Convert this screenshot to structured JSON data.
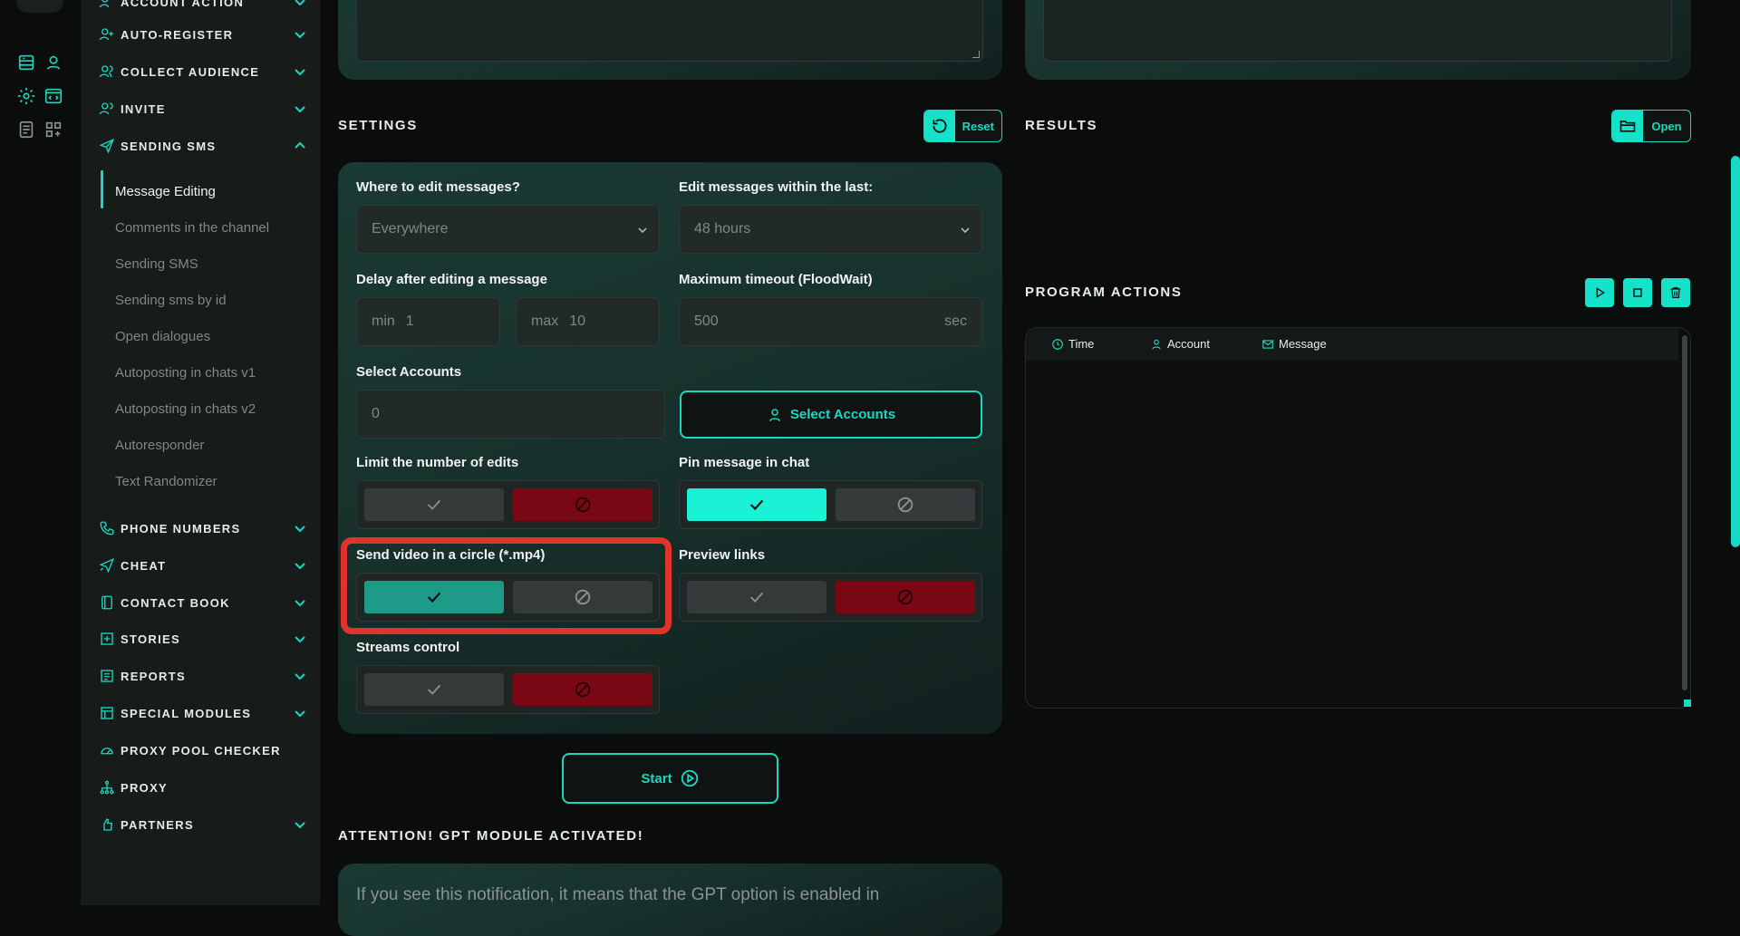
{
  "sidebar": {
    "items": [
      {
        "label": "ACCOUNT ACTION",
        "icon": "user-gear-icon",
        "expanded": false
      },
      {
        "label": "AUTO-REGISTER",
        "icon": "user-plus-icon",
        "expanded": false
      },
      {
        "label": "COLLECT AUDIENCE",
        "icon": "users-icon",
        "expanded": false
      },
      {
        "label": "INVITE",
        "icon": "users-invite-icon",
        "expanded": false
      },
      {
        "label": "SENDING SMS",
        "icon": "paper-plane-icon",
        "expanded": true
      },
      {
        "label": "PHONE NUMBERS",
        "icon": "phone-icon",
        "expanded": false
      },
      {
        "label": "CHEAT",
        "icon": "send-boost-icon",
        "expanded": false
      },
      {
        "label": "CONTACT BOOK",
        "icon": "book-icon",
        "expanded": false
      },
      {
        "label": "STORIES",
        "icon": "plus-square-icon",
        "expanded": false
      },
      {
        "label": "REPORTS",
        "icon": "report-icon",
        "expanded": false
      },
      {
        "label": "SPECIAL MODULES",
        "icon": "modules-icon",
        "expanded": false
      },
      {
        "label": "PROXY POOL CHECKER",
        "icon": "gauge-icon",
        "expanded": false
      },
      {
        "label": "PROXY",
        "icon": "network-icon",
        "expanded": false
      },
      {
        "label": "PARTNERS",
        "icon": "handshake-icon",
        "expanded": false
      }
    ],
    "sending_sms_subitems": [
      "Message Editing",
      "Comments in the channel",
      "Sending SMS",
      "Sending sms by id",
      "Open dialogues",
      "Autoposting in chats v1",
      "Autoposting in chats v2",
      "Autoresponder",
      "Text Randomizer"
    ],
    "active_subitem": "Message Editing"
  },
  "settings": {
    "title": "SETTINGS",
    "reset_label": "Reset",
    "where_label": "Where to edit messages?",
    "where_value": "Everywhere",
    "within_label": "Edit messages within the last:",
    "within_value": "48 hours",
    "delay_label": "Delay after editing a message",
    "delay_min_prefix": "min",
    "delay_min": "1",
    "delay_max_prefix": "max",
    "delay_max": "10",
    "timeout_label": "Maximum timeout (FloodWait)",
    "timeout_value": "500",
    "timeout_unit": "sec",
    "accounts_label": "Select Accounts",
    "accounts_count": "0",
    "select_accounts_button": "Select Accounts",
    "limit_label": "Limit the number of edits",
    "limit_state": "off",
    "pin_label": "Pin message in chat",
    "pin_state": "on",
    "video_label": "Send video in a circle (*.mp4)",
    "video_state": "on",
    "preview_label": "Preview links",
    "preview_state": "off",
    "streams_label": "Streams control",
    "streams_state": "off"
  },
  "start_label": "Start",
  "attention": {
    "title": "ATTENTION! GPT MODULE ACTIVATED!",
    "text": "If you see this notification, it means that the GPT option is enabled in"
  },
  "results": {
    "title": "RESULTS",
    "open_label": "Open"
  },
  "program_actions": {
    "title": "PROGRAM ACTIONS",
    "columns": [
      "Time",
      "Account",
      "Message"
    ]
  },
  "colors": {
    "accent": "#15d9c1",
    "highlight": "#e0342b",
    "off_red": "#7a0714"
  }
}
